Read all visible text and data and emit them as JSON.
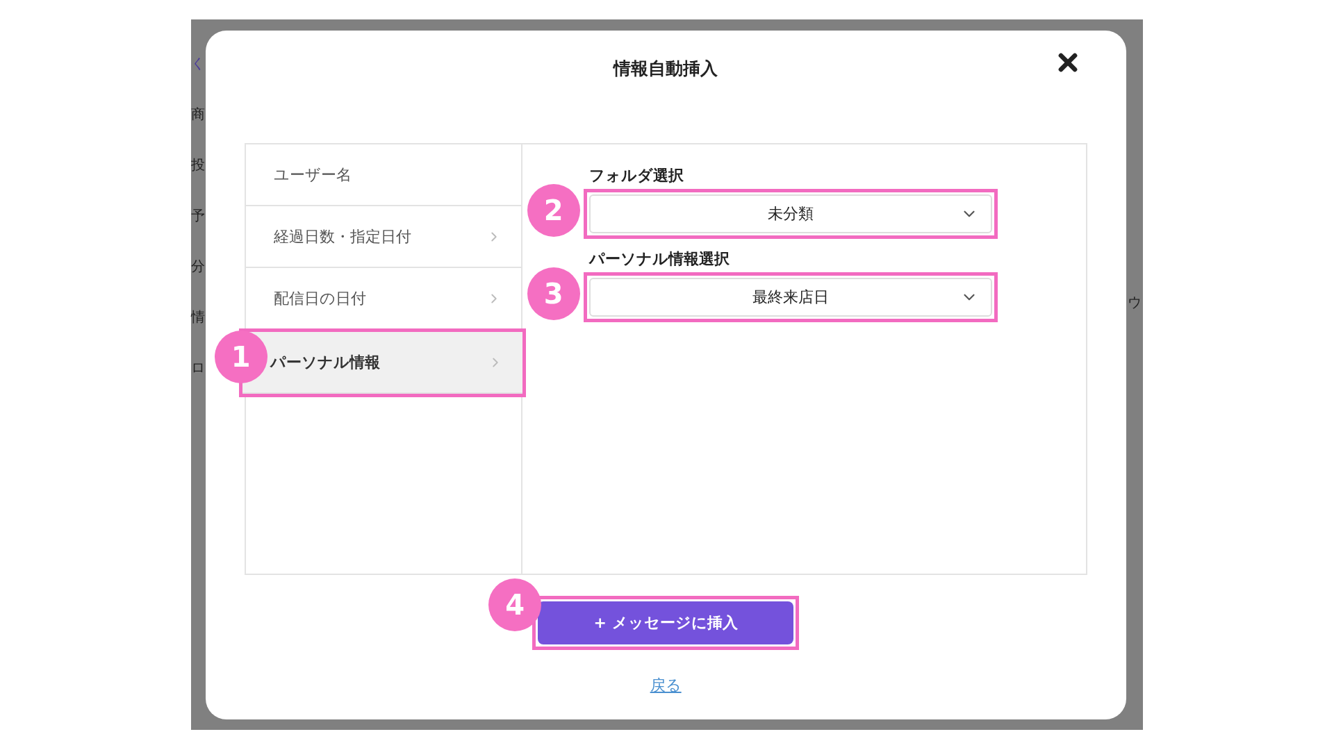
{
  "background": {
    "left_fragments": [
      {
        "text": "く",
        "kind": "link"
      },
      {
        "text": "商",
        "kind": "plain"
      },
      {
        "text": "投",
        "kind": "plain"
      },
      {
        "text": "予",
        "kind": "plain"
      },
      {
        "text": "分",
        "kind": "plain"
      },
      {
        "text": "情",
        "kind": "plain"
      },
      {
        "text": "ロ",
        "kind": "plain"
      }
    ],
    "right_fragments": [
      "ウ"
    ]
  },
  "dialog": {
    "title": "情報自動挿入",
    "menu": [
      {
        "label": "ユーザー名",
        "selected": false,
        "has_arrow": false
      },
      {
        "label": "経過日数・指定日付",
        "selected": false,
        "has_arrow": true
      },
      {
        "label": "配信日の日付",
        "selected": false,
        "has_arrow": true
      },
      {
        "label": "パーソナル情報",
        "selected": true,
        "has_arrow": true,
        "annotation": "1"
      }
    ],
    "fields": [
      {
        "label": "フォルダ選択",
        "value": "未分類",
        "annotation": "2"
      },
      {
        "label": "パーソナル情報選択",
        "value": "最終来店日",
        "annotation": "3"
      }
    ],
    "submit": {
      "label": "+ メッセージに挿入",
      "annotation": "4"
    },
    "back_link": "戻る"
  }
}
